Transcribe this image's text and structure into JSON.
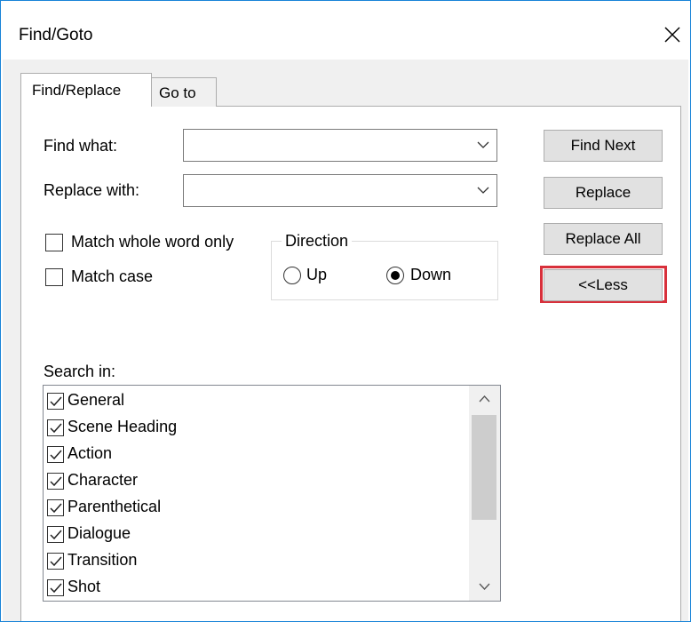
{
  "window": {
    "title": "Find/Goto",
    "close_icon": "close-icon"
  },
  "tabs": [
    {
      "label": "Find/Replace",
      "active": true
    },
    {
      "label": "Go to",
      "active": false
    }
  ],
  "find": {
    "label": "Find what:",
    "value": "",
    "dropdown_icon": "chevron-down-icon"
  },
  "replace": {
    "label": "Replace with:",
    "value": "",
    "dropdown_icon": "chevron-down-icon"
  },
  "options": {
    "match_whole_word": {
      "label": "Match whole word only",
      "checked": false
    },
    "match_case": {
      "label": "Match case",
      "checked": false
    }
  },
  "direction": {
    "title": "Direction",
    "up": {
      "label": "Up",
      "checked": false
    },
    "down": {
      "label": "Down",
      "checked": true
    }
  },
  "buttons": {
    "find_next": "Find Next",
    "replace": "Replace",
    "replace_all": "Replace All",
    "less": "<<Less",
    "highlight_color": "#d8303b"
  },
  "search_in": {
    "label": "Search in:",
    "items": [
      {
        "label": "General",
        "checked": true
      },
      {
        "label": "Scene Heading",
        "checked": true
      },
      {
        "label": "Action",
        "checked": true
      },
      {
        "label": "Character",
        "checked": true
      },
      {
        "label": "Parenthetical",
        "checked": true
      },
      {
        "label": "Dialogue",
        "checked": true
      },
      {
        "label": "Transition",
        "checked": true
      },
      {
        "label": "Shot",
        "checked": true
      }
    ]
  },
  "colors": {
    "window_border": "#1883d7",
    "dialog_background": "#f0f0f0",
    "button_face": "#e1e1e1"
  }
}
